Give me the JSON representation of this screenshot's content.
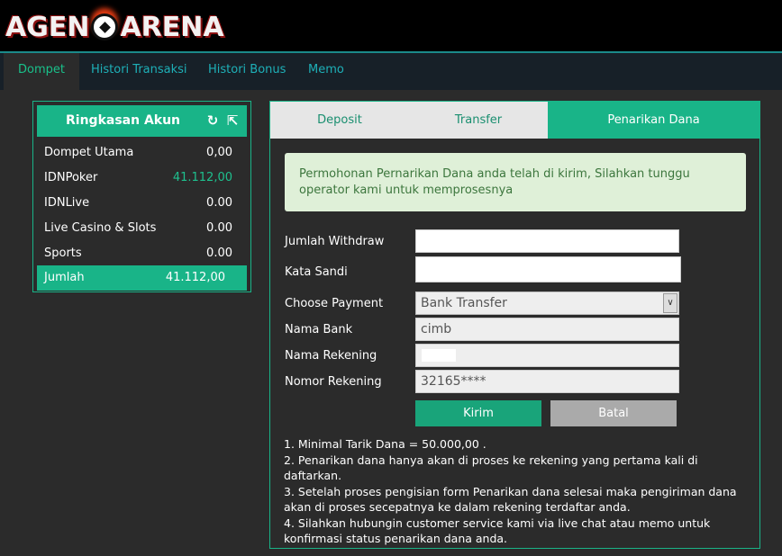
{
  "brand": {
    "logo_text_left": "AGEN",
    "logo_text_right": "ARENA"
  },
  "nav": {
    "tabs": [
      {
        "label": "Dompet",
        "active": true
      },
      {
        "label": "Histori Transaksi",
        "active": false
      },
      {
        "label": "Histori Bonus",
        "active": false
      },
      {
        "label": "Memo",
        "active": false
      }
    ]
  },
  "summary": {
    "title": "Ringkasan Akun",
    "refresh_icon": "refresh-icon",
    "transfer_icon": "arrow-up-icon",
    "rows": [
      {
        "label": "Dompet Utama",
        "value": "0,00"
      },
      {
        "label": "IDNPoker",
        "value": "41.112,00"
      },
      {
        "label": "IDNLive",
        "value": "0.00"
      },
      {
        "label": "Live Casino & Slots",
        "value": "0.00"
      },
      {
        "label": "Sports",
        "value": "0.00"
      }
    ],
    "total": {
      "label": "Jumlah",
      "value": "41.112,00"
    }
  },
  "tabs": [
    {
      "label": "Deposit",
      "active": false
    },
    {
      "label": "Transfer",
      "active": false
    },
    {
      "label": "Penarikan Dana",
      "active": true
    }
  ],
  "alert": {
    "text": "Permohonan Pernarikan Dana anda telah di kirim, Silahkan tunggu operator kami untuk memprosesnya"
  },
  "form": {
    "jumlah_withdraw_label": "Jumlah Withdraw",
    "jumlah_withdraw_value": "",
    "kata_sandi_label": "Kata Sandi",
    "kata_sandi_value": "",
    "payment_label": "Choose Payment",
    "payment_value": "Bank Transfer",
    "nama_bank_label": "Nama Bank",
    "nama_bank_value": "cimb",
    "nama_rekening_label": "Nama Rekening",
    "nomor_rekening_label": "Nomor Rekening",
    "nomor_rekening_value": "32165****",
    "submit_label": "Kirim",
    "cancel_label": "Batal"
  },
  "notes": [
    "1. Minimal Tarik Dana = 50.000,00 .",
    "2. Penarikan dana hanya akan di proses ke rekening yang pertama kali di daftarkan.",
    "3. Setelah proses pengisian form Penarikan dana selesai maka pengiriman dana akan di proses secepatnya ke dalam rekening terdaftar anda.",
    "4. Silahkan hubungin customer service kami via live chat atau memo untuk konfirmasi status penarikan dana anda."
  ],
  "colors": {
    "accent": "#19b488",
    "nav_text": "#1eb0b8",
    "alert_bg": "#dff0d8"
  }
}
